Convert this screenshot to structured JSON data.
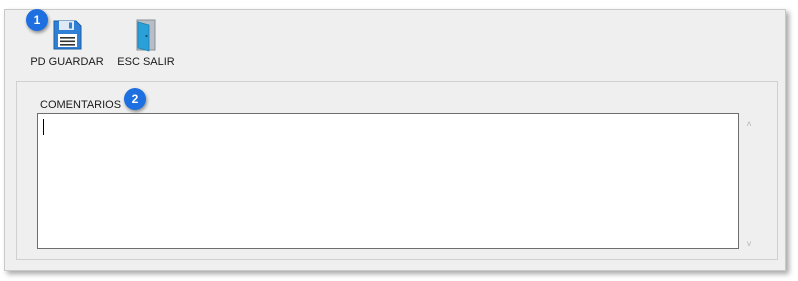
{
  "toolbar": {
    "save_label": "PD GUARDAR",
    "exit_label": "ESC SALIR",
    "save_icon": "floppy-disk-icon",
    "exit_icon": "door-exit-icon"
  },
  "callouts": {
    "badge_1": "1",
    "badge_2": "2",
    "color": "#1e6fe0"
  },
  "comments": {
    "label": "COMENTARIOS",
    "value": ""
  },
  "scrollbar": {
    "up_glyph": "˄",
    "down_glyph": "˅"
  }
}
